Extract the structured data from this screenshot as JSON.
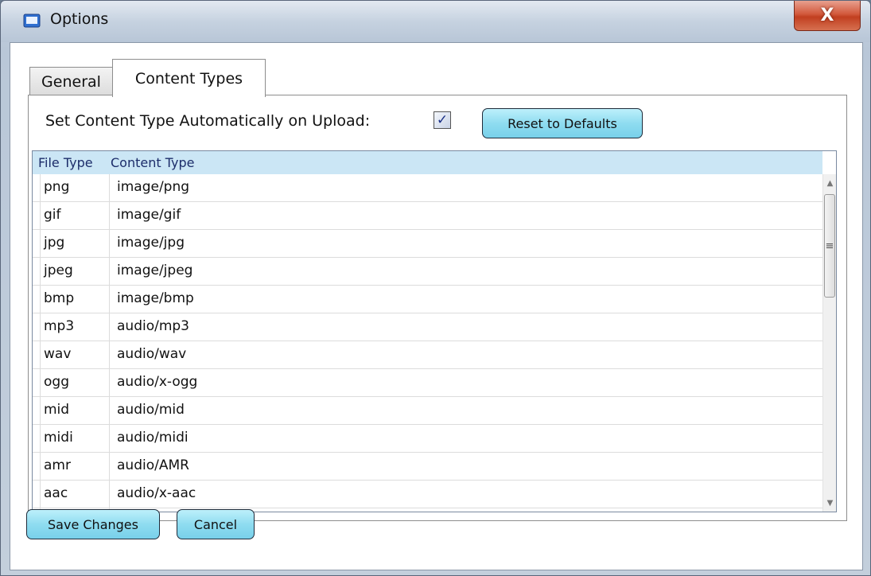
{
  "window": {
    "title": "Options",
    "close_glyph": "X",
    "icon": "window-app-icon"
  },
  "tabs": [
    {
      "label": "General",
      "selected": false
    },
    {
      "label": "Content Types",
      "selected": true
    }
  ],
  "content_types": {
    "auto_label": "Set Content Type Automatically on Upload:",
    "auto_checked": true,
    "checkbox_glyph": "✓",
    "reset_label": "Reset to Defaults",
    "columns": [
      "File Type",
      "Content Type"
    ],
    "rows": [
      {
        "file_type": "png",
        "content_type": "image/png"
      },
      {
        "file_type": "gif",
        "content_type": "image/gif"
      },
      {
        "file_type": "jpg",
        "content_type": "image/jpg"
      },
      {
        "file_type": "jpeg",
        "content_type": "image/jpeg"
      },
      {
        "file_type": "bmp",
        "content_type": "image/bmp"
      },
      {
        "file_type": "mp3",
        "content_type": "audio/mp3"
      },
      {
        "file_type": "wav",
        "content_type": "audio/wav"
      },
      {
        "file_type": "ogg",
        "content_type": "audio/x-ogg"
      },
      {
        "file_type": "mid",
        "content_type": "audio/mid"
      },
      {
        "file_type": "midi",
        "content_type": "audio/midi"
      },
      {
        "file_type": "amr",
        "content_type": "audio/AMR"
      },
      {
        "file_type": "aac",
        "content_type": "audio/x-aac"
      }
    ],
    "scroll_icons": {
      "up": "▲",
      "thumb": "≡",
      "down": "▼"
    }
  },
  "footer": {
    "save_label": "Save Changes",
    "cancel_label": "Cancel"
  },
  "colors": {
    "button_bg": "#8fdcf0",
    "grid_header_bg": "#cbe6f5",
    "close_button": "#c13f20"
  }
}
